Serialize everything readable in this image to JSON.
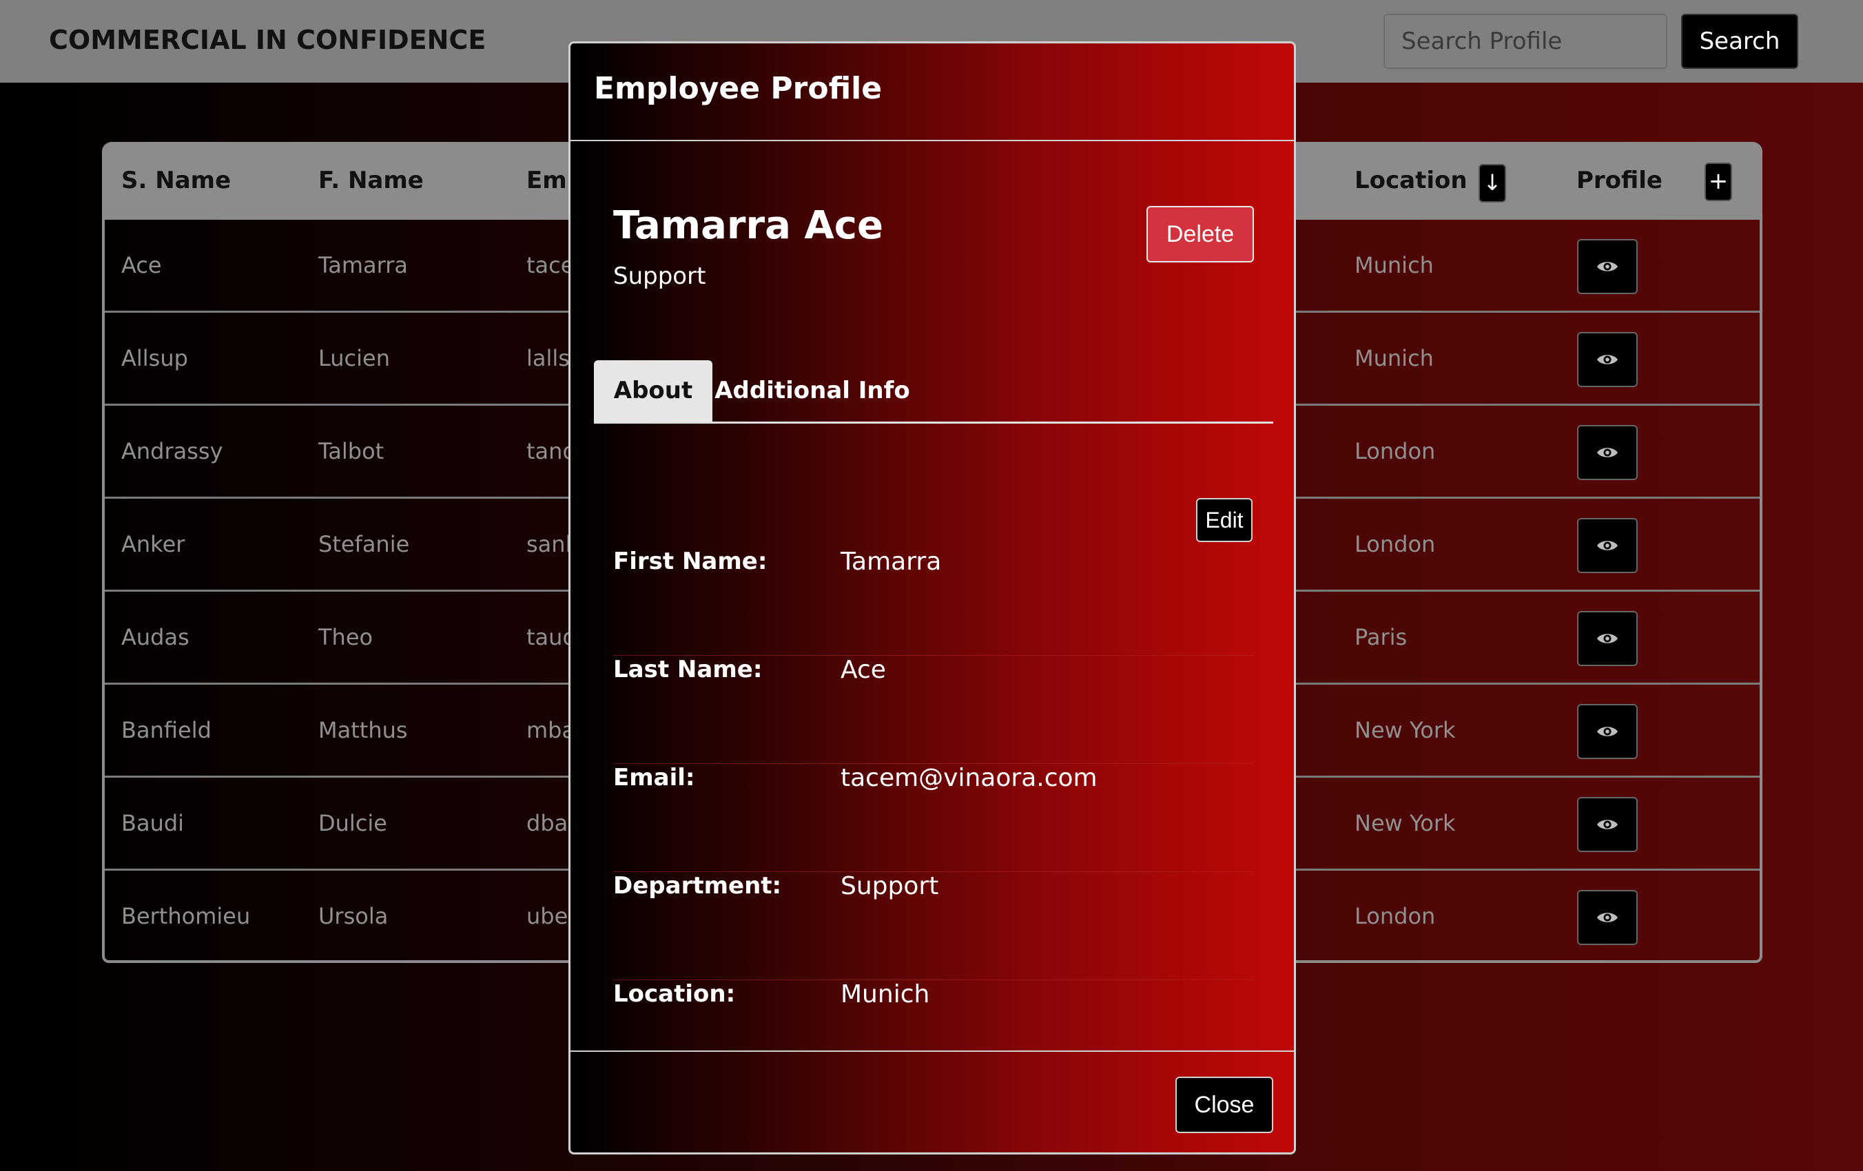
{
  "header": {
    "brand": "COMMERCIAL IN CONFIDENCE",
    "search_placeholder": "Search Profile",
    "search_label": "Search"
  },
  "table": {
    "columns": {
      "surname": "S. Name",
      "first_name": "F. Name",
      "email": "Em",
      "location": "Location",
      "profile": "Profile"
    },
    "sort_icon": "arrow-down-icon",
    "add_icon": "plus-icon",
    "view_icon": "eye-icon",
    "rows": [
      {
        "surname": "Ace",
        "first_name": "Tamarra",
        "email": "tace",
        "location": "Munich"
      },
      {
        "surname": "Allsup",
        "first_name": "Lucien",
        "email": "lalls",
        "location": "Munich"
      },
      {
        "surname": "Andrassy",
        "first_name": "Talbot",
        "email": "tand",
        "location": "London"
      },
      {
        "surname": "Anker",
        "first_name": "Stefanie",
        "email": "sank",
        "location": "London"
      },
      {
        "surname": "Audas",
        "first_name": "Theo",
        "email": "taud",
        "location": "Paris"
      },
      {
        "surname": "Banfield",
        "first_name": "Matthus",
        "email": "mba",
        "location": "New York"
      },
      {
        "surname": "Baudi",
        "first_name": "Dulcie",
        "email": "dba",
        "location": "New York"
      },
      {
        "surname": "Berthomieu",
        "first_name": "Ursola",
        "email": "ube",
        "location": "London"
      }
    ]
  },
  "modal": {
    "title": "Employee Profile",
    "employee_name": "Tamarra Ace",
    "employee_department": "Support",
    "delete_label": "Delete",
    "tabs": [
      {
        "label": "About",
        "active": true
      },
      {
        "label": "Additional Info",
        "active": false
      }
    ],
    "edit_label": "Edit",
    "fields": [
      {
        "label": "First Name:",
        "value": "Tamarra"
      },
      {
        "label": "Last Name:",
        "value": "Ace"
      },
      {
        "label": "Email:",
        "value": "tacem@vinaora.com"
      },
      {
        "label": "Department:",
        "value": "Support"
      },
      {
        "label": "Location:",
        "value": "Munich"
      }
    ],
    "close_label": "Close"
  },
  "colors": {
    "header_bg": "#808080",
    "delete": "#d3333f",
    "modal_gradient_end": "#c20808"
  }
}
